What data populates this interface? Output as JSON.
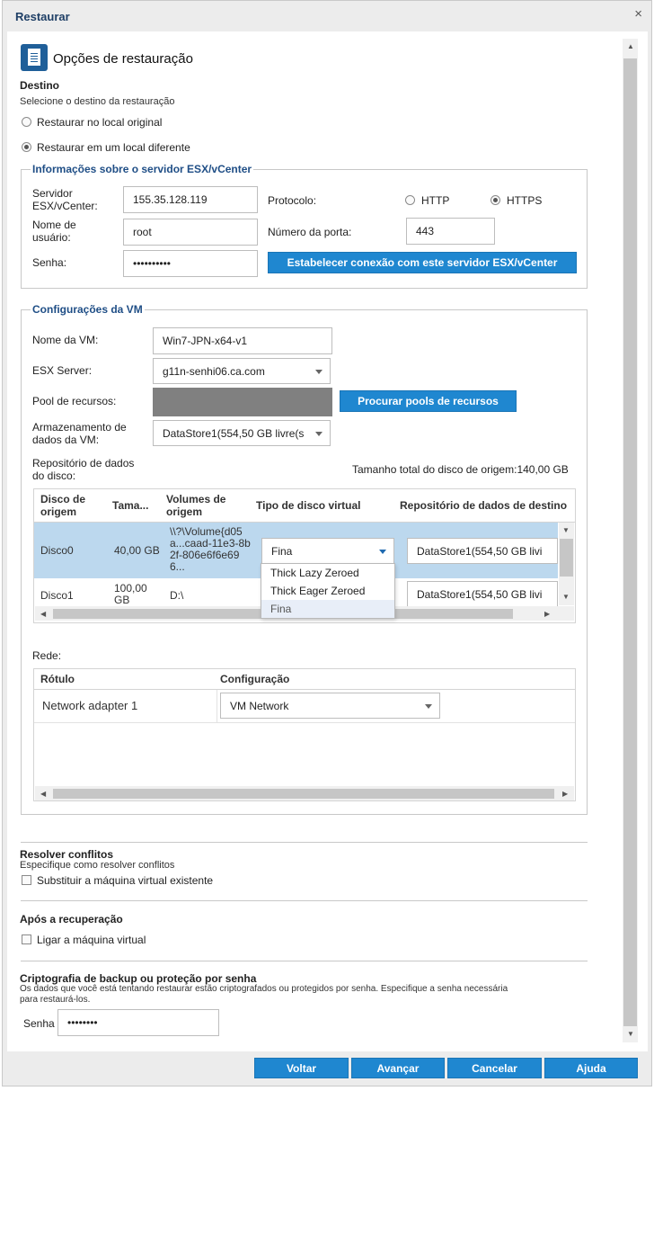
{
  "window": {
    "title": "Restaurar",
    "close": "×"
  },
  "header": {
    "title": "Opções de restauração"
  },
  "destination": {
    "label": "Destino",
    "hint": "Selecione o destino da restauração",
    "opt_original": "Restaurar no local original",
    "opt_different": "Restaurar em um local diferente",
    "selected": "different"
  },
  "server": {
    "legend": "Informações sobre o servidor ESX/vCenter",
    "server_label_1": "Servidor",
    "server_label_2": "ESX/vCenter:",
    "server_value": "155.35.128.119",
    "user_label_1": "Nome de",
    "user_label_2": "usuário:",
    "user_value": "root",
    "pass_label": "Senha:",
    "pass_value": "••••••••••",
    "protocol_label": "Protocolo:",
    "http": "HTTP",
    "https": "HTTPS",
    "protocol_selected": "HTTPS",
    "port_label": "Número da porta:",
    "port_value": "443",
    "connect_button": "Estabelecer conexão com este servidor ESX/vCenter"
  },
  "vm": {
    "legend": "Configurações da VM",
    "name_label": "Nome da VM:",
    "name_value": "Win7-JPN-x64-v1",
    "esx_label": "ESX Server:",
    "esx_value": "g11n-senhi06.ca.com",
    "pool_label": "Pool de recursos:",
    "pool_button": "Procurar pools de recursos",
    "storage_label_1": "Armazenamento de",
    "storage_label_2": "dados da VM:",
    "storage_value": "DataStore1(554,50 GB livre(s",
    "disk_repo_label_1": "Repositório de dados",
    "disk_repo_label_2": "do disco:",
    "total_size": "Tamanho total do disco de origem:140,00 GB"
  },
  "disk_table": {
    "columns": [
      "Disco de origem",
      "Tama...",
      "Volumes de origem",
      "Tipo de disco virtual",
      "Repositório de dados de destino"
    ],
    "rows": [
      {
        "disk": "Disco0",
        "size": "40,00 GB",
        "volume": "\\\\?\\Volume{d05a...caad-11e3-8b2f-806e6f6e696...",
        "type": "Fina",
        "repo": "DataStore1(554,50 GB livi"
      },
      {
        "disk": "Disco1",
        "size": "100,00 GB",
        "volume": "D:\\",
        "type": "",
        "repo": "DataStore1(554,50 GB livi"
      }
    ],
    "dropdown_options": [
      "Thick Lazy Zeroed",
      "Thick Eager Zeroed",
      "Fina"
    ]
  },
  "network": {
    "label": "Rede:",
    "columns": [
      "Rótulo",
      "Configuração"
    ],
    "rows": [
      {
        "label": "Network adapter 1",
        "config": "VM Network"
      }
    ]
  },
  "conflicts": {
    "title": "Resolver conflitos",
    "hint": "Especifique como resolver conflitos",
    "option": "Substituir a máquina virtual existente"
  },
  "after": {
    "title": "Após a recuperação",
    "option": "Ligar a máquina virtual"
  },
  "encryption": {
    "title": "Criptografia de backup ou proteção por senha",
    "hint_1": "Os dados que você está tentando restaurar estão criptografados ou protegidos por senha. Especifique a senha necessária",
    "hint_2": "para restaurá-los.",
    "pass_label": "Senha",
    "pass_value": "••••••••"
  },
  "footer": {
    "back": "Voltar",
    "next": "Avançar",
    "cancel": "Cancelar",
    "help": "Ajuda"
  },
  "colors": {
    "accent": "#1f87d0",
    "legend": "#1f4e86",
    "selected_row": "#bcd8ee"
  }
}
